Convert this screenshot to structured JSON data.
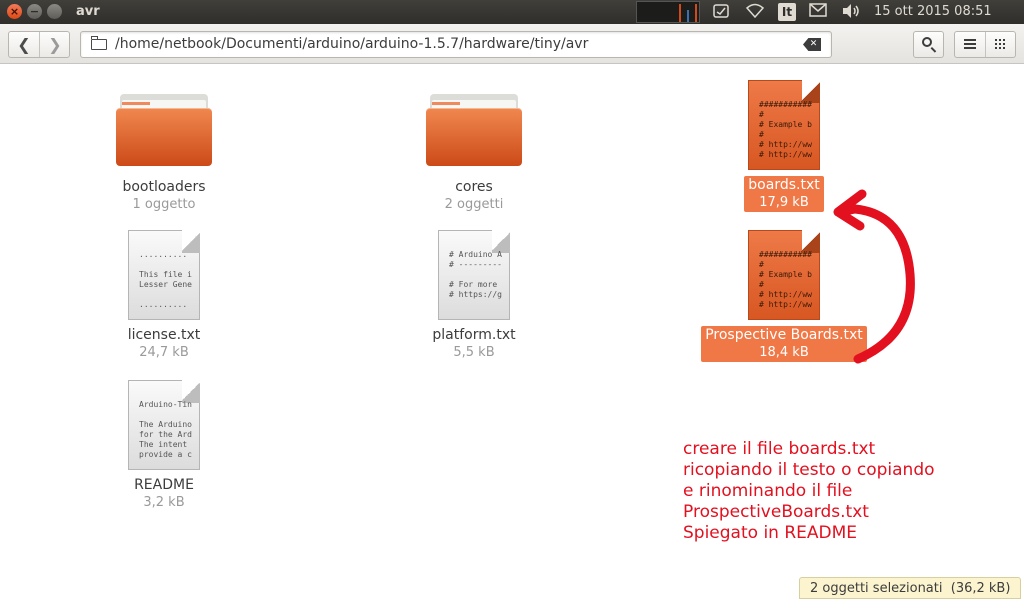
{
  "window": {
    "title": "avr"
  },
  "panel": {
    "clock": "15 ott 2015 08:51",
    "keyboard_layout": "It",
    "icons": [
      "system-monitor-icon",
      "dropbox-icon",
      "wifi-icon",
      "keyboard-icon",
      "mail-icon",
      "volume-icon"
    ]
  },
  "toolbar": {
    "path": "/home/netbook/Documenti/arduino/arduino-1.5.7/hardware/tiny/avr"
  },
  "items": [
    {
      "name": "bootloaders",
      "meta": "1 oggetto",
      "type": "folder",
      "selected": false
    },
    {
      "name": "cores",
      "meta": "2 oggetti",
      "type": "folder",
      "selected": false
    },
    {
      "name": "boards.txt",
      "meta": "17,9 kB",
      "type": "text",
      "selected": true,
      "preview": "###########\n#\n# Example b\n#\n# http://ww\n# http://ww"
    },
    {
      "name": "license.txt",
      "meta": "24,7 kB",
      "type": "text",
      "selected": false,
      "preview": "..........\n\nThis file i\nLesser Gene\n\n.........."
    },
    {
      "name": "platform.txt",
      "meta": "5,5 kB",
      "type": "text",
      "selected": false,
      "preview": "# Arduino A\n# ---------\n\n# For more\n# https://g"
    },
    {
      "name": "Prospective Boards.txt",
      "meta": "18,4 kB",
      "type": "text",
      "selected": true,
      "preview": "###########\n#\n# Example b\n#\n# http://ww\n# http://ww"
    },
    {
      "name": "README",
      "meta": "3,2 kB",
      "type": "text",
      "selected": false,
      "preview": "Arduino-Tin\n\nThe Arduino\nfor the Ard\nThe intent\nprovide a c"
    }
  ],
  "annotation": {
    "text": "creare il file boards.txt\nricopiando il testo o copiando\ne rinominando il file\nProspectiveBoards.txt\nSpiegato in README",
    "color": "#e3101f"
  },
  "status": {
    "text": "2 oggetti selezionati  (36,2 kB)"
  },
  "colors": {
    "accent": "#f07746",
    "panel": "#3c3b37"
  }
}
